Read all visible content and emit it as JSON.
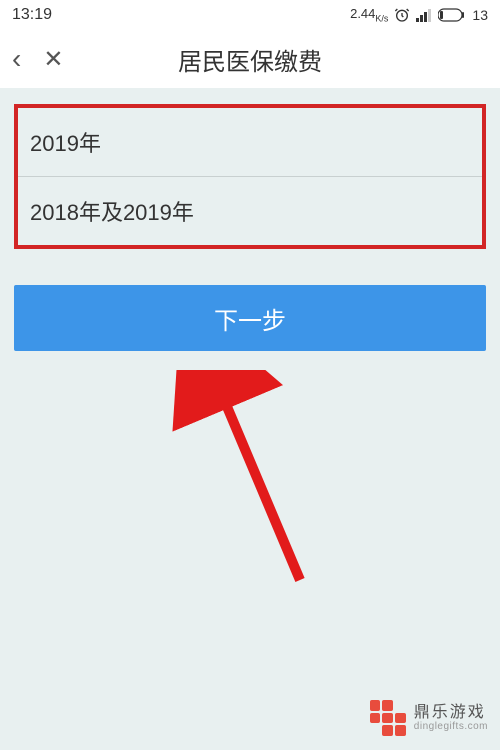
{
  "status_bar": {
    "time": "13:19",
    "speed_value": "2.44",
    "speed_unit": "K/s",
    "battery_text": "13"
  },
  "nav": {
    "title": "居民医保缴费"
  },
  "options": {
    "year_2019": "2019年",
    "year_2018_2019": "2018年及2019年"
  },
  "buttons": {
    "next": "下一步"
  },
  "annotation": {
    "arrow_color": "#e21b1b"
  },
  "watermark": {
    "cn": "鼎乐游戏",
    "en": "dinglegifts.com"
  }
}
